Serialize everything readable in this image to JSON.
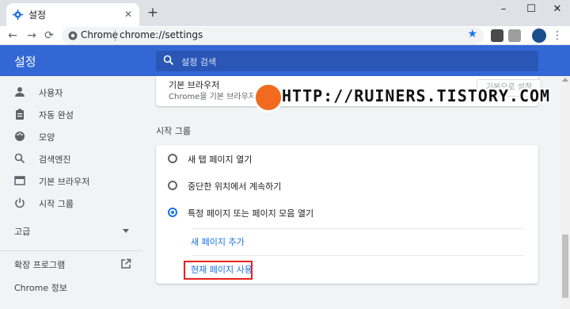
{
  "tab": {
    "title": "설정",
    "close_icon": "close-icon"
  },
  "window": {
    "minimize": "–",
    "maximize": "☐",
    "close": "✕"
  },
  "toolbar": {
    "back": "←",
    "forward": "→",
    "reload": "⟳",
    "origin": "Chrome",
    "url": "chrome://settings",
    "star": "★",
    "menu": "⋮"
  },
  "header": {
    "title": "설정",
    "search_placeholder": "설정 검색"
  },
  "sidebar": {
    "items": [
      {
        "label": "사용자",
        "icon": "person-icon"
      },
      {
        "label": "자동 완성",
        "icon": "clipboard-icon"
      },
      {
        "label": "모양",
        "icon": "palette-icon"
      },
      {
        "label": "검색엔진",
        "icon": "search-icon"
      },
      {
        "label": "기본 브라우저",
        "icon": "browser-icon"
      },
      {
        "label": "시작 그룹",
        "icon": "power-icon"
      }
    ],
    "advanced": "고급",
    "extensions": "확장 프로그램",
    "about": "Chrome 정보"
  },
  "main": {
    "default_browser": {
      "title": "기본 브라우저",
      "description": "Chrome을 기본 브라우저로",
      "button": "기본으로 설정"
    },
    "startup": {
      "title": "시작 그룹",
      "options": [
        {
          "label": "새 탭 페이지 열기",
          "selected": false
        },
        {
          "label": "중단한 위치에서 계속하기",
          "selected": false
        },
        {
          "label": "특정 페이지 또는 페이지 모음 열기",
          "selected": true
        }
      ],
      "add_page": "새 페이지 추가",
      "use_current": "현재 페이지 사용"
    }
  },
  "watermark": {
    "text": "HTTP://RUINERS.TISTORY.COM"
  },
  "colors": {
    "accent": "#3367d6",
    "link": "#1a73e8",
    "highlight": "#e8211c",
    "watermark_logo": "#f26a20"
  }
}
